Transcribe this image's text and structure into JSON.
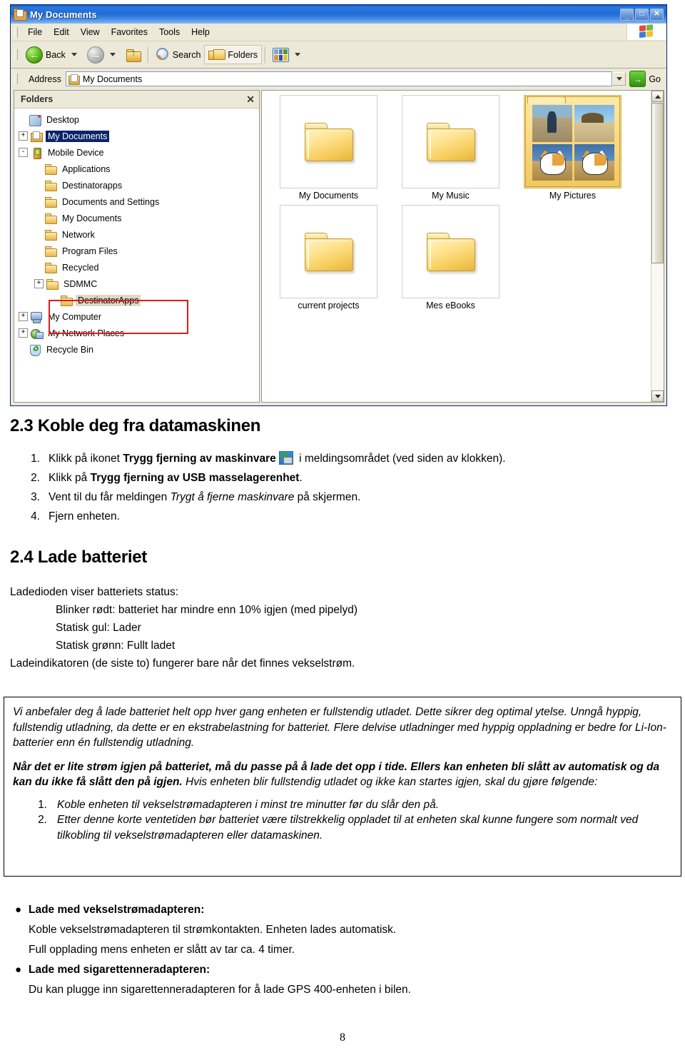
{
  "explorer": {
    "title": "My Documents",
    "title_icon": "folder-document-icon",
    "window_buttons": {
      "minimize": "_",
      "maximize": "□",
      "close": "✕"
    },
    "menu": [
      {
        "label": "File",
        "accel": "F"
      },
      {
        "label": "Edit",
        "accel": "E"
      },
      {
        "label": "View",
        "accel": "V"
      },
      {
        "label": "Favorites",
        "accel": "a"
      },
      {
        "label": "Tools",
        "accel": "T"
      },
      {
        "label": "Help",
        "accel": "H"
      }
    ],
    "toolbar": {
      "back": "Back",
      "forward": "",
      "up": "",
      "search": "Search",
      "folders": "Folders",
      "views": ""
    },
    "address": {
      "label": "Address",
      "value": "My Documents",
      "go_label": "Go"
    },
    "folder_pane": {
      "header": "Folders",
      "close": "✕",
      "tree": [
        {
          "label": "Desktop",
          "indent": 0,
          "expander": "",
          "icon": "desktop-icon",
          "state": "normal"
        },
        {
          "label": "My Documents",
          "indent": 0,
          "expander": "+",
          "icon": "my-documents-icon",
          "state": "selected"
        },
        {
          "label": "Mobile Device",
          "indent": 0,
          "expander": "-",
          "icon": "mobile-device-icon",
          "state": "normal"
        },
        {
          "label": "Applications",
          "indent": 1,
          "expander": "",
          "icon": "folder-icon",
          "state": "normal"
        },
        {
          "label": "Destinatorapps",
          "indent": 1,
          "expander": "",
          "icon": "folder-icon",
          "state": "normal"
        },
        {
          "label": "Documents and Settings",
          "indent": 1,
          "expander": "",
          "icon": "folder-icon",
          "state": "normal"
        },
        {
          "label": "My Documents",
          "indent": 1,
          "expander": "",
          "icon": "folder-icon",
          "state": "normal"
        },
        {
          "label": "Network",
          "indent": 1,
          "expander": "",
          "icon": "folder-icon",
          "state": "normal"
        },
        {
          "label": "Program Files",
          "indent": 1,
          "expander": "",
          "icon": "folder-icon",
          "state": "normal"
        },
        {
          "label": "Recycled",
          "indent": 1,
          "expander": "",
          "icon": "folder-icon",
          "state": "normal"
        },
        {
          "label": "SDMMC",
          "indent": 1,
          "expander": "+",
          "icon": "folder-icon",
          "state": "normal"
        },
        {
          "label": "DestinatorApps",
          "indent": 2,
          "expander": "",
          "icon": "folder-icon",
          "state": "soft"
        },
        {
          "label": "My Computer",
          "indent": 0,
          "expander": "+",
          "icon": "my-computer-icon",
          "state": "normal"
        },
        {
          "label": "My Network Places",
          "indent": 0,
          "expander": "+",
          "icon": "network-places-icon",
          "state": "normal"
        },
        {
          "label": "Recycle Bin",
          "indent": 0,
          "expander": "",
          "icon": "recycle-bin-icon",
          "state": "normal"
        }
      ],
      "highlight_color": "#e01b1b"
    },
    "items": [
      {
        "label": "My Documents",
        "icon": "folder-icon"
      },
      {
        "label": "My Music",
        "icon": "folder-icon"
      },
      {
        "label": "My Pictures",
        "icon": "pictures-folder-icon"
      },
      {
        "label": "current projects",
        "icon": "folder-icon"
      },
      {
        "label": "Mes eBooks",
        "icon": "folder-icon"
      }
    ]
  },
  "doc": {
    "section_23": {
      "heading": "2.3 Koble deg fra datamaskinen",
      "steps": [
        {
          "num": "1.",
          "pre": "Klikk på ikonet ",
          "bold": "Trygg fjerning av maskinvare",
          "icon": "safely-remove-hardware-icon",
          "post": " i meldingsområdet (ved siden av klokken)."
        },
        {
          "num": "2.",
          "pre": "Klikk på ",
          "bold": "Trygg fjerning av USB masselagerenhet",
          "icon": "",
          "post": "."
        },
        {
          "num": "3.",
          "pre": "Vent til du får meldingen ",
          "italic": "Trygt å fjerne maskinvare",
          "post2": " på skjermen."
        },
        {
          "num": "4.",
          "pre": "Fjern enheten.",
          "post": ""
        }
      ]
    },
    "section_24": {
      "heading": "2.4 Lade batteriet",
      "intro": "Ladedioden viser batteriets status:",
      "states": [
        "Blinker rødt: batteriet har mindre enn 10% igjen (med pipelyd)",
        "Statisk gul: Lader",
        "Statisk grønn: Fullt ladet"
      ],
      "note": "Ladeindikatoren (de siste to) fungerer bare når det finnes vekselstrøm."
    },
    "framed_note": {
      "para1": "Vi anbefaler deg å lade batteriet helt opp hver gang enheten er fullstendig utladet. Dette sikrer deg optimal ytelse. Unngå hyppig, fullstendig utladning, da dette er en ekstrabelastning for batteriet. Flere delvise utladninger med hyppig oppladning er bedre for Li-Ion-batterier enn én fullstendig utladning.",
      "para2_bold": "Når det er lite strøm igjen på batteriet, må du passe på å lade det opp i tide. Ellers kan enheten bli slått av automatisk og da kan du ikke få slått den på igjen.",
      "para2_rest": " Hvis enheten blir fullstendig utladet og ikke kan startes igjen, skal du gjøre følgende:",
      "steps": [
        {
          "num": "1.",
          "text": "Koble enheten til vekselstrømadapteren i minst tre minutter før du slår den på."
        },
        {
          "num": "2.",
          "text": "Etter denne korte ventetiden bør batteriet være tilstrekkelig oppladet til at enheten skal kunne fungere som normalt ved tilkobling til vekselstrømadapteren eller datamaskinen."
        }
      ]
    },
    "bullets": [
      {
        "bullet": "●",
        "title": "Lade med vekselstrømadapteren:",
        "lines": [
          "Koble vekselstrømadapteren til strømkontakten. Enheten lades automatisk.",
          "Full opplading mens enheten er slått av tar ca. 4 timer."
        ]
      },
      {
        "bullet": "●",
        "title": "Lade med sigarettenneradapteren:",
        "lines": [
          "Du kan plugge inn sigarettenneradapteren for å lade GPS 400-enheten i bilen."
        ]
      }
    ],
    "page_number": "8"
  }
}
